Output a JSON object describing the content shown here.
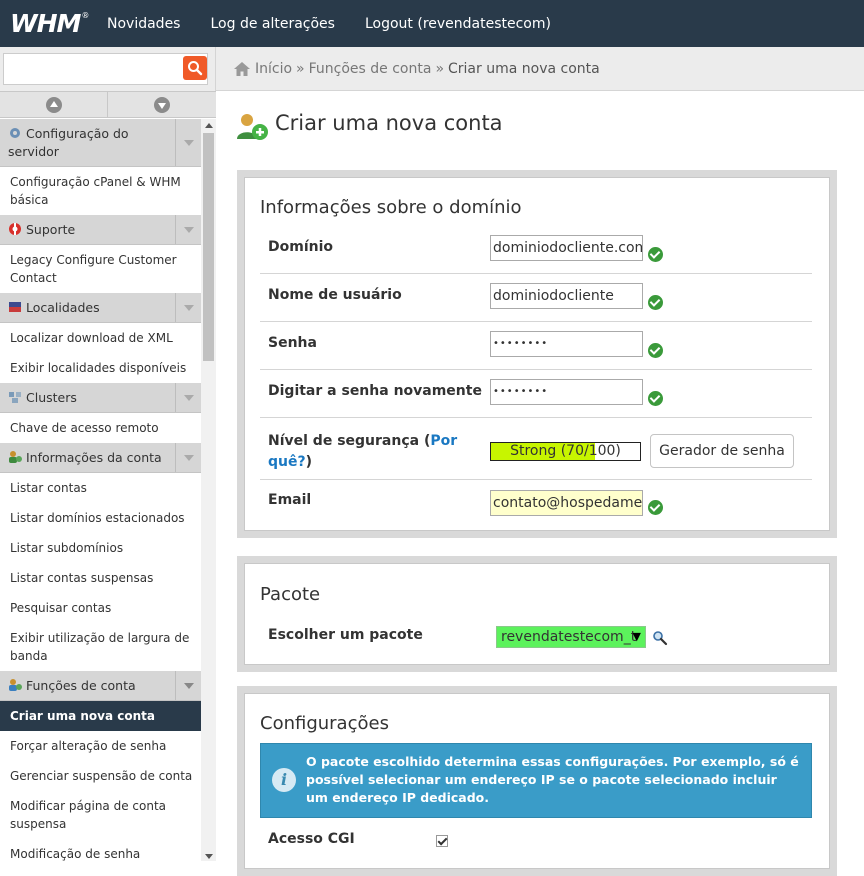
{
  "topbar": {
    "logo": "WHM",
    "logo_mark": "®",
    "nav": [
      "Novidades",
      "Log de alterações",
      "Logout (revendatestecom)"
    ]
  },
  "sidebar": {
    "search_value": "",
    "groups": [
      {
        "header": "Configuração do servidor",
        "icon": "gear-icon",
        "items": [
          "Configuração cPanel & WHM básica"
        ]
      },
      {
        "header": "Suporte",
        "icon": "lifebuoy-icon",
        "items": [
          "Legacy Configure Customer Contact"
        ]
      },
      {
        "header": "Localidades",
        "icon": "flag-icon",
        "items": [
          "Localizar download de XML",
          "Exibir localidades disponíveis"
        ]
      },
      {
        "header": "Clusters",
        "icon": "cluster-icon",
        "items": [
          "Chave de acesso remoto"
        ]
      },
      {
        "header": "Informações da conta",
        "icon": "account-info-icon",
        "items": [
          "Listar contas",
          "Listar domínios estacionados",
          "Listar subdomínios",
          "Listar contas suspensas",
          "Pesquisar contas",
          "Exibir utilização de largura de banda"
        ]
      },
      {
        "header": "Funções de conta",
        "icon": "account-functions-icon",
        "items": [
          "Criar uma nova conta",
          "Forçar alteração de senha",
          "Gerenciar suspensão de conta",
          "Modificar página de conta suspensa",
          "Modificação de senha"
        ]
      }
    ],
    "active_item": "Criar uma nova conta"
  },
  "breadcrumb": {
    "items": [
      "Início",
      "Funções de conta"
    ],
    "separator": "»",
    "current": "Criar uma nova conta"
  },
  "page": {
    "title": "Criar uma nova conta"
  },
  "domain_section": {
    "title": "Informações sobre o domínio",
    "domain_label": "Domínio",
    "domain_value": "dominiodocliente.com.",
    "username_label": "Nome de usuário",
    "username_value": "dominiodocliente",
    "password_label": "Senha",
    "password_value": "••••••••",
    "password_confirm_label": "Digitar a senha novamente",
    "password_confirm_value": "••••••••",
    "strength_label": "Nível de segurança (",
    "strength_link": "Por quê?",
    "strength_label_end": ")",
    "strength_text": "Strong (70/100)",
    "strength_value": 70,
    "generator_button": "Gerador de senha",
    "email_label": "Email",
    "email_value": "contato@hospedameu"
  },
  "package_section": {
    "title": "Pacote",
    "choose_label": "Escolher um pacote",
    "selected_package": "revendatestecom_t",
    "select_color": "#5cf25c"
  },
  "settings_section": {
    "title": "Configurações",
    "info_text": "O pacote escolhido determina essas configurações. Por exemplo, só é possível selecionar um endereço IP se o pacote selecionado incluir um endereço IP dedicado.",
    "cgi_label": "Acesso CGI",
    "cgi_checked": true
  },
  "colors": {
    "topbar": "#293a4a",
    "accent": "#f05a28",
    "ok_green": "#3a9a3a",
    "info_blue": "#3a9cc8",
    "link": "#1a78c2"
  }
}
